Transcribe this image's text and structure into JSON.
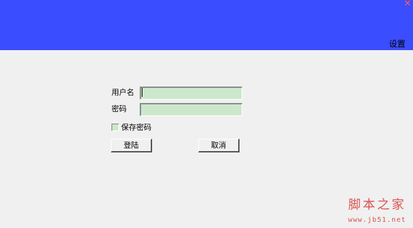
{
  "header": {
    "close_glyph": "✕",
    "settings_label": "设置",
    "background_color": "#3a4dff"
  },
  "form": {
    "username_label": "用户名",
    "username_value": "",
    "password_label": "密码",
    "password_value": "",
    "remember_label": "保存密码",
    "remember_checked": false,
    "field_color": "#cbe8cc"
  },
  "buttons": {
    "login_label": "登陆",
    "cancel_label": "取消"
  },
  "watermark": {
    "brand": "脚本之家",
    "url": "www.jb51.net"
  }
}
